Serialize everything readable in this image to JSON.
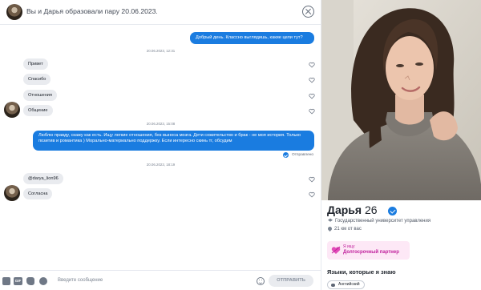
{
  "header": {
    "title": "Вы и Дарья образовали пару 20.06.2023.",
    "close_icon": "close-circle-icon"
  },
  "messages": [
    {
      "direction": "out",
      "text": "Добрый день. Классно выглядишь, какие цели тут?"
    },
    {
      "direction": "timestamp",
      "text": "20.06.2023, 12:31"
    },
    {
      "direction": "in",
      "text": "Привет"
    },
    {
      "direction": "in",
      "text": "Спасибо"
    },
    {
      "direction": "in",
      "text": "Отношения"
    },
    {
      "direction": "in",
      "text": "Общение"
    },
    {
      "direction": "timestamp",
      "text": "20.06.2023, 15:08"
    },
    {
      "direction": "out",
      "text": "Люблю правду, скажу как есть. Ищу легкие отношения, без выноса мозга. Дети сожительство и брак - не моя история. Только позитив и романтика ) Морально-материально поддержку. Если интересно скинь тг, обсудим"
    },
    {
      "direction": "status",
      "text": "Отправлено"
    },
    {
      "direction": "timestamp",
      "text": "20.06.2023, 18:19"
    },
    {
      "direction": "in",
      "text": "@darya_lion96"
    },
    {
      "direction": "in",
      "text": "Согласна"
    }
  ],
  "composer": {
    "placeholder": "Введите сообщение",
    "send_label": "ОТПРАВИТЬ",
    "icons": [
      "image-icon",
      "gif-icon",
      "sticker-icon",
      "spotify-icon",
      "emoji-icon"
    ],
    "gif_label": "GIF"
  },
  "profile": {
    "name": "Дарья",
    "age": "26",
    "school": "Государственный университет управления",
    "distance": "21 км от вас",
    "goal_caption": "Я ищу",
    "goal_value": "Долгосрочный партнер",
    "languages_title": "Языки, которые я знаю",
    "languages": [
      "Английский"
    ]
  },
  "colors": {
    "accent": "#1a7ce0",
    "goal_pink": "#c0209c",
    "goal_bg": "#fde8f6",
    "bubble_in": "#e9ebef"
  }
}
